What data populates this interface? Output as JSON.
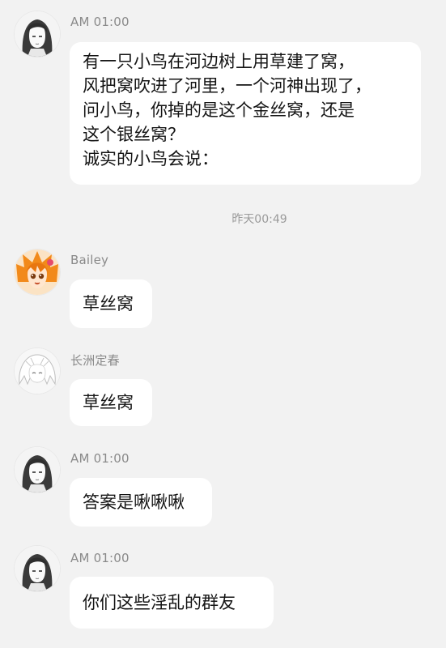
{
  "messages": [
    {
      "sender": "AM 01:00",
      "avatar_icon": "anime-girl-sketch-avatar",
      "lines": [
        "有一只小鸟在河边树上用草建了窝，",
        "风把窝吹进了河里，一个河神出现了，",
        "问小鸟，你掉的是这个金丝窝，还是",
        "这个银丝窝？",
        "诚实的小鸟会说："
      ]
    },
    {
      "sender": "Bailey",
      "avatar_icon": "orange-hair-anime-avatar",
      "lines": [
        "草丝窝"
      ]
    },
    {
      "sender": "长洲定春",
      "avatar_icon": "white-hair-sketch-avatar",
      "lines": [
        "草丝窝"
      ]
    },
    {
      "sender": "AM 01:00",
      "avatar_icon": "anime-girl-sketch-avatar",
      "lines": [
        "答案是啾啾啾"
      ]
    },
    {
      "sender": "AM 01:00",
      "avatar_icon": "anime-girl-sketch-avatar",
      "lines": [
        "你们这些淫乱的群友"
      ]
    }
  ],
  "divider": {
    "text": "昨天00:49"
  },
  "colors": {
    "background": "#f2f2f2",
    "bubble": "#ffffff",
    "name": "#8a8a8a",
    "text": "#141414"
  }
}
